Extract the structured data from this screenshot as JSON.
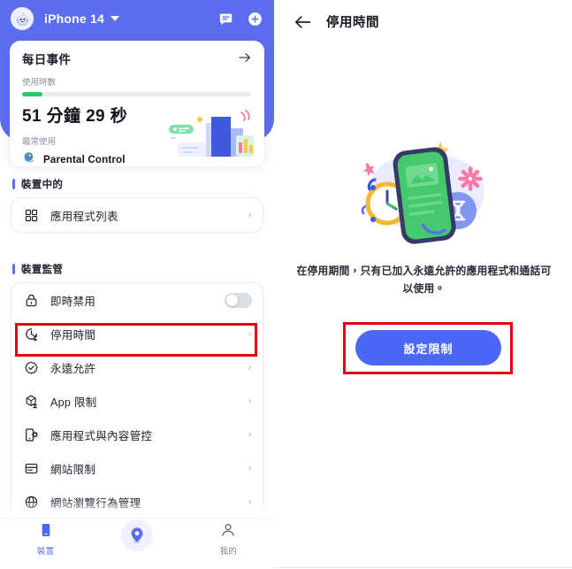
{
  "left_panel": {
    "topbar": {
      "avatar_icon": "monster-avatar-icon",
      "device_name": "iPhone 14",
      "dropdown_icon": "chevron-down-icon",
      "message_icon": "message-icon",
      "add_icon": "plus-circle-icon"
    },
    "usage_card": {
      "title": "每日事件",
      "arrow_icon": "arrow-right-icon",
      "usage_label": "使用時數",
      "progress_percent": 9,
      "progress_color": "#2fc66a",
      "usage_time": "51 分鐘 29 秒",
      "most_used_label": "最常使用",
      "most_used_app": "Parental Control",
      "app_icon": "parental-control-app-icon",
      "illustration": "usage-chart-illustration"
    },
    "sections": [
      {
        "id": "device",
        "title": "裝置中的",
        "rows": [
          {
            "label": "應用程式列表",
            "icon": "grid-apps-icon",
            "accessory": "chevron"
          }
        ]
      },
      {
        "id": "monitor",
        "title": "裝置監管",
        "rows": [
          {
            "label": "即時禁用",
            "icon": "lock-icon",
            "accessory": "toggle",
            "toggle_on": false
          },
          {
            "label": "停用時間",
            "icon": "clock-hourglass-icon",
            "accessory": "chevron",
            "highlighted": true
          },
          {
            "label": "永遠允許",
            "icon": "check-badge-icon",
            "accessory": "chevron"
          },
          {
            "label": "App 限制",
            "icon": "app-box-icon",
            "accessory": "chevron"
          },
          {
            "label": "應用程式與內容管控",
            "icon": "phone-gear-icon",
            "accessory": "chevron"
          },
          {
            "label": "網站限制",
            "icon": "browser-window-icon",
            "accessory": "chevron"
          },
          {
            "label": "網站瀏覽行為管理",
            "icon": "globe-icon",
            "accessory": "chevron"
          }
        ]
      }
    ],
    "bottom_nav": [
      {
        "label": "裝置",
        "icon": "device-icon",
        "active": true
      },
      {
        "label": "",
        "icon": "location-pin-icon",
        "active": false
      },
      {
        "label": "我的",
        "icon": "person-icon",
        "active": false
      }
    ]
  },
  "right_panel": {
    "back_icon": "arrow-left-icon",
    "title": "停用時間",
    "illustration": "downtime-phone-clock-illustration",
    "description": "在停用期間，只有已加入永遠允許的應用程式和通話可以使用。",
    "primary_button": "設定限制"
  },
  "annotations": {
    "highlight_color": "#e60012",
    "boxes": [
      {
        "name": "menu-item-downtime-highlight"
      },
      {
        "name": "set-limit-button-highlight"
      }
    ]
  },
  "theme": {
    "brand_blue": "#5b6ef0",
    "button_blue": "#4a68f5",
    "green": "#2fc66a",
    "text_dark": "#20232f",
    "text_muted": "#8a8f9e"
  }
}
